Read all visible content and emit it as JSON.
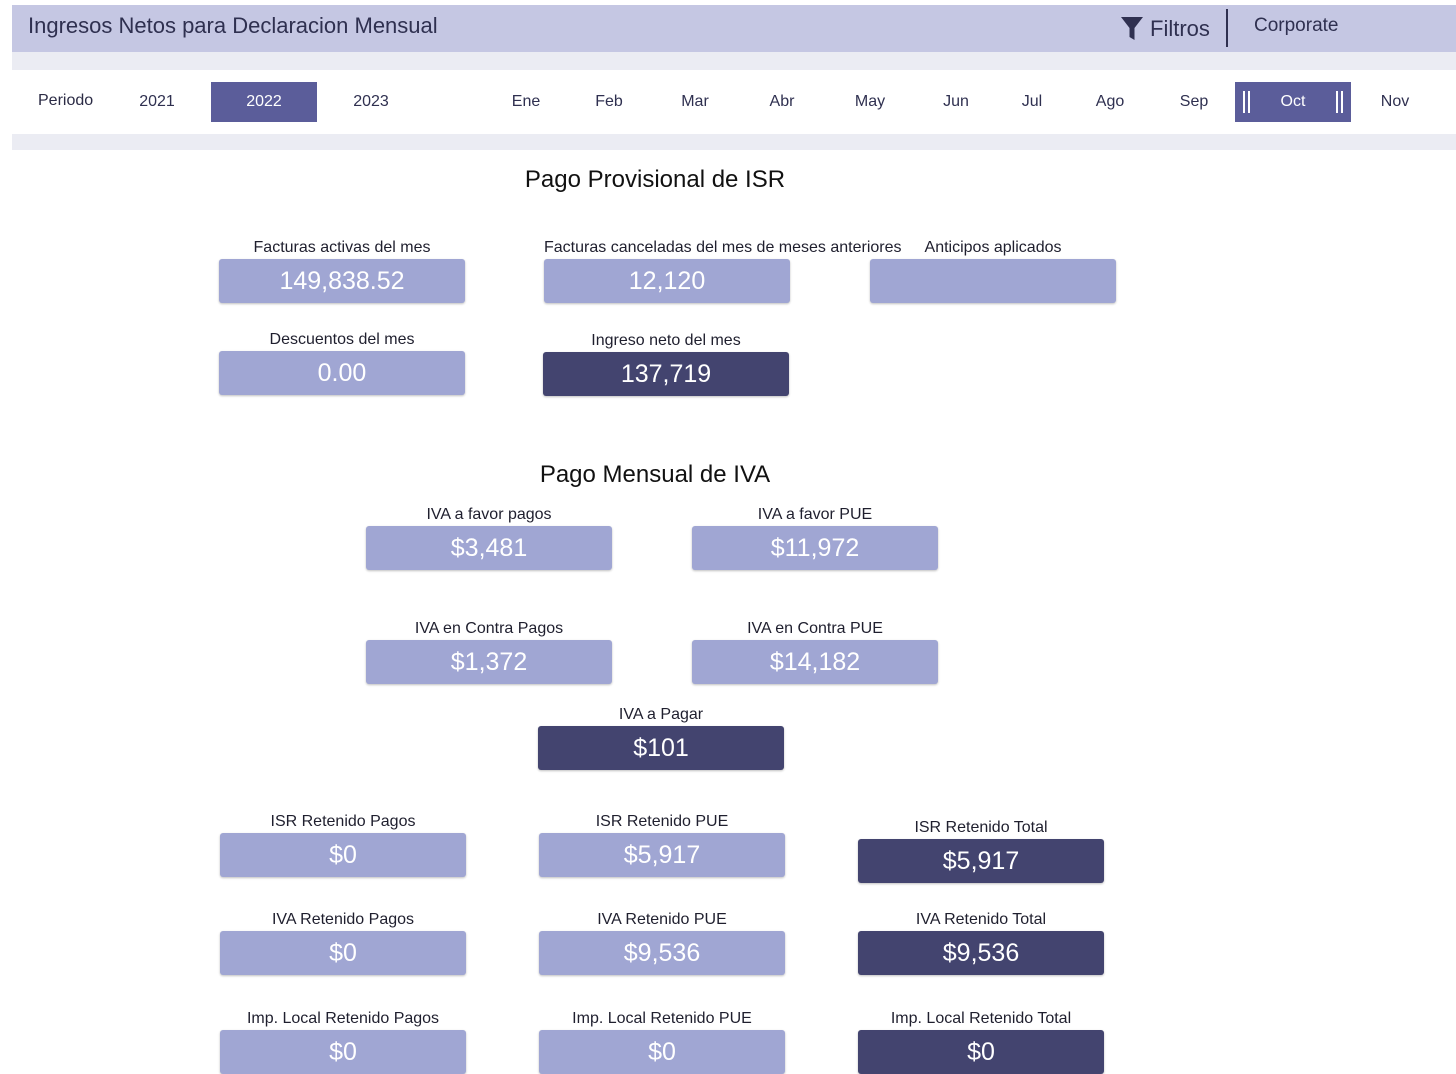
{
  "header": {
    "title": "Ingresos Netos para Declaracion Mensual",
    "filters_label": "Filtros",
    "corporate_label": "Corporate",
    "filter_icon": "funnel-icon"
  },
  "period": {
    "label": "Periodo",
    "years": [
      "2021",
      "2022",
      "2023"
    ],
    "selected_year": "2022",
    "months": [
      "Ene",
      "Feb",
      "Mar",
      "Abr",
      "May",
      "Jun",
      "Jul",
      "Ago",
      "Sep",
      "Oct",
      "Nov"
    ],
    "selected_month": "Oct"
  },
  "isr": {
    "title": "Pago Provisional de ISR",
    "facturas_activas": {
      "label": "Facturas activas del mes",
      "value": "149,838.52"
    },
    "facturas_canceladas": {
      "label": "Facturas canceladas del mes de meses anteriores",
      "value": "12,120"
    },
    "anticipos": {
      "label": "Anticipos aplicados",
      "value": ""
    },
    "descuentos": {
      "label": "Descuentos del mes",
      "value": "0.00"
    },
    "ingreso_neto": {
      "label": "Ingreso neto del mes",
      "value": "137,719"
    }
  },
  "iva": {
    "title": "Pago Mensual de IVA",
    "favor_pagos": {
      "label": "IVA a favor pagos",
      "value": "$3,481"
    },
    "favor_pue": {
      "label": "IVA a favor PUE",
      "value": "$11,972"
    },
    "contra_pagos": {
      "label": "IVA en Contra Pagos",
      "value": "$1,372"
    },
    "contra_pue": {
      "label": "IVA en Contra PUE",
      "value": "$14,182"
    },
    "a_pagar": {
      "label": "IVA a Pagar",
      "value": "$101"
    }
  },
  "retenciones": {
    "isr_pagos": {
      "label": "ISR Retenido Pagos",
      "value": "$0"
    },
    "isr_pue": {
      "label": "ISR Retenido PUE",
      "value": "$5,917"
    },
    "isr_total": {
      "label": "ISR Retenido Total",
      "value": "$5,917"
    },
    "iva_pagos": {
      "label": "IVA Retenido Pagos",
      "value": "$0"
    },
    "iva_pue": {
      "label": "IVA Retenido PUE",
      "value": "$9,536"
    },
    "iva_total": {
      "label": "IVA Retenido Total",
      "value": "$9,536"
    },
    "local_pagos": {
      "label": "Imp. Local Retenido Pagos",
      "value": "$0"
    },
    "local_pue": {
      "label": "Imp. Local Retenido PUE",
      "value": "$0"
    },
    "local_total": {
      "label": "Imp. Local Retenido Total",
      "value": "$0"
    }
  },
  "colors": {
    "header_bg": "#c5c7e3",
    "card_light": "#a0a6d3",
    "card_dark": "#43446f",
    "selected": "#5b5d9a"
  }
}
